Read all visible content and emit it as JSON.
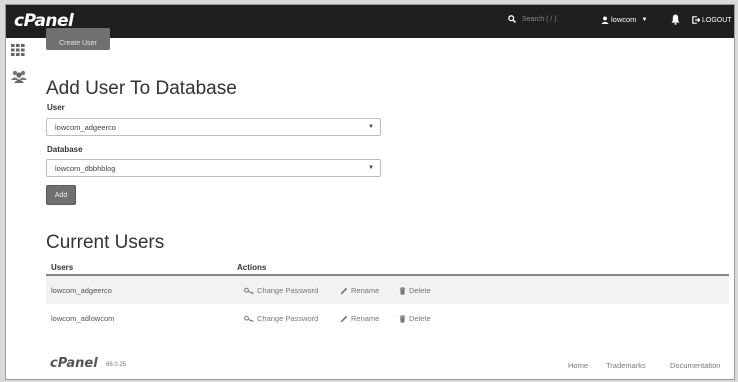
{
  "header": {
    "logo": "cPanel",
    "search_placeholder": "Search ( / )",
    "username": "lowcom",
    "logout": "LOGOUT"
  },
  "create_user_button": "Create User",
  "add_user_section": {
    "title": "Add User To Database",
    "user_label": "User",
    "user_value": "lowcom_adgeerco",
    "database_label": "Database",
    "database_value": "lowcom_dbbhblog",
    "add_button": "Add"
  },
  "current_users": {
    "title": "Current Users",
    "columns": [
      "Users",
      "Actions"
    ],
    "rows": [
      {
        "user": "lowcom_adgeerco"
      },
      {
        "user": "lowcom_adlowcom"
      }
    ],
    "actions": {
      "change_password": "Change Password",
      "rename": "Rename",
      "delete": "Delete"
    }
  },
  "footer": {
    "logo": "cPanel",
    "version": "66.0.25",
    "links": [
      "Home",
      "Trademarks",
      "Documentation"
    ]
  }
}
